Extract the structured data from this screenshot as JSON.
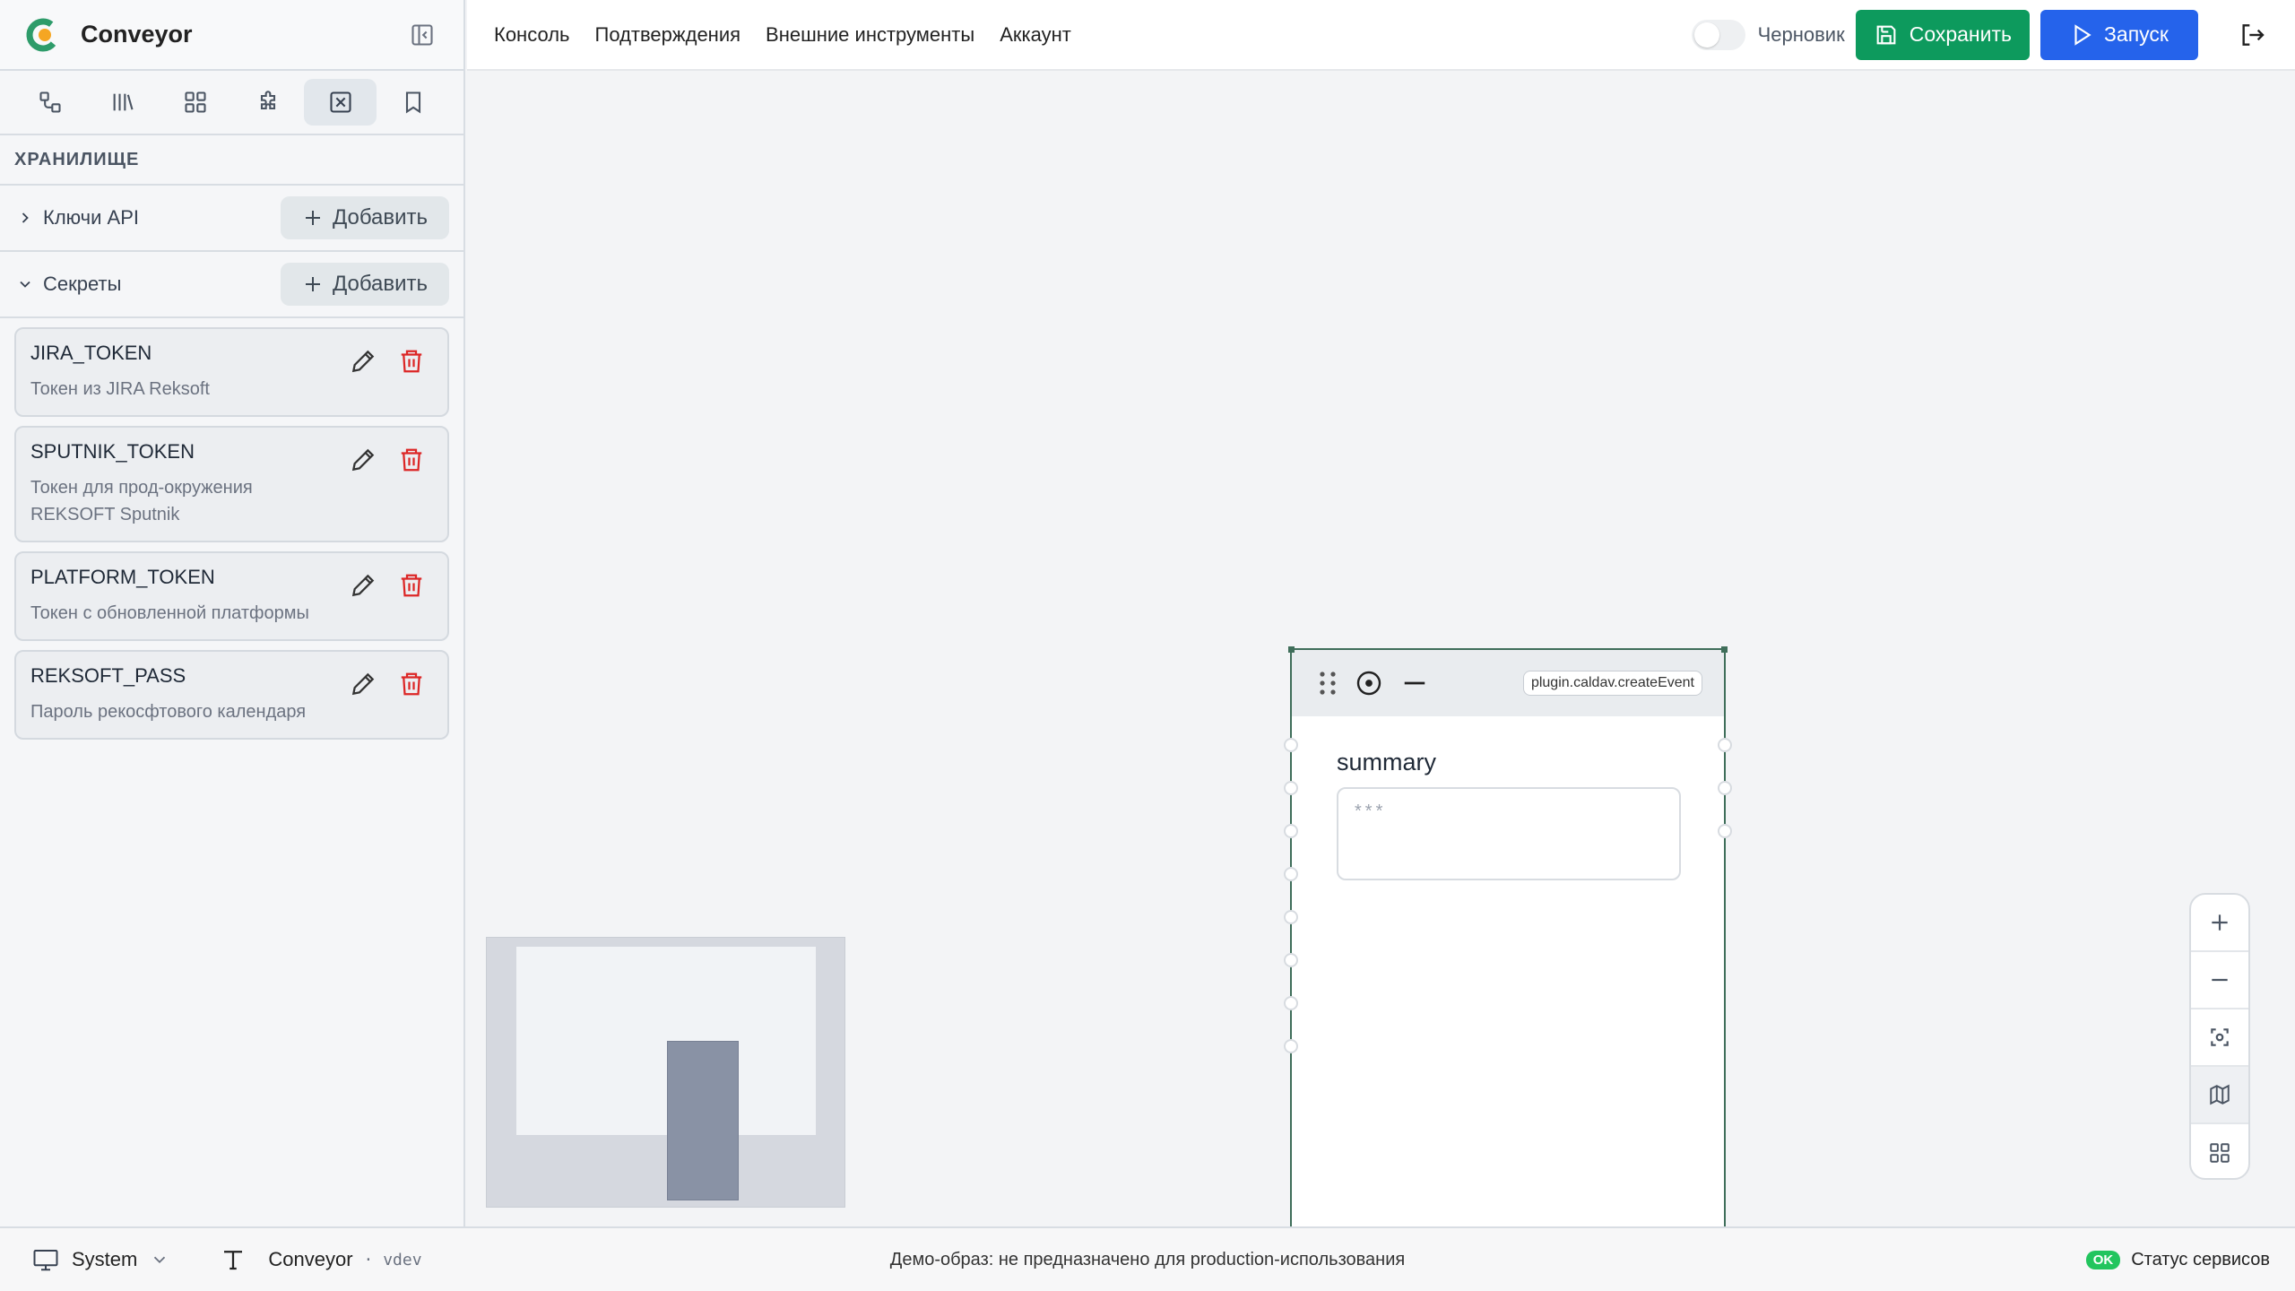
{
  "app": {
    "title": "Conveyor"
  },
  "sidebar": {
    "section_title": "ХРАНИЛИЩЕ",
    "groups": [
      {
        "label": "Ключи API",
        "add_label": "Добавить",
        "expanded": false
      },
      {
        "label": "Секреты",
        "add_label": "Добавить",
        "expanded": true
      }
    ],
    "secrets": [
      {
        "name": "JIRA_TOKEN",
        "description": "Токен из JIRA Reksoft"
      },
      {
        "name": "SPUTNIK_TOKEN",
        "description": "Токен для прод-окружения REKSOFT Sputnik"
      },
      {
        "name": "PLATFORM_TOKEN",
        "description": "Токен с обновленной платформы"
      },
      {
        "name": "REKSOFT_PASS",
        "description": "Пароль рекосфтового календаря"
      }
    ],
    "tabs": [
      "flow-icon",
      "library-icon",
      "grid-icon",
      "puzzle-icon",
      "vault-icon",
      "bookmark-icon"
    ],
    "active_tab": 4
  },
  "topbar": {
    "nav": [
      "Консоль",
      "Подтверждения",
      "Внешние инструменты",
      "Аккаунт"
    ],
    "draft_label": "Черновик",
    "draft_on": false,
    "save_label": "Сохранить",
    "run_label": "Запуск"
  },
  "node": {
    "badge": "plugin.caldav.createEvent",
    "field_label": "summary",
    "field_value": "***"
  },
  "footer": {
    "theme": "System",
    "title": "Conveyor",
    "version": "· vdev",
    "notice": "Демо-образ: не предназначено для production-использования",
    "status_badge": "OK",
    "status_label": "Статус сервисов"
  },
  "colors": {
    "save": "#0d9a5d",
    "run": "#2563eb",
    "delete": "#dc2626",
    "ok": "#22c55e"
  }
}
